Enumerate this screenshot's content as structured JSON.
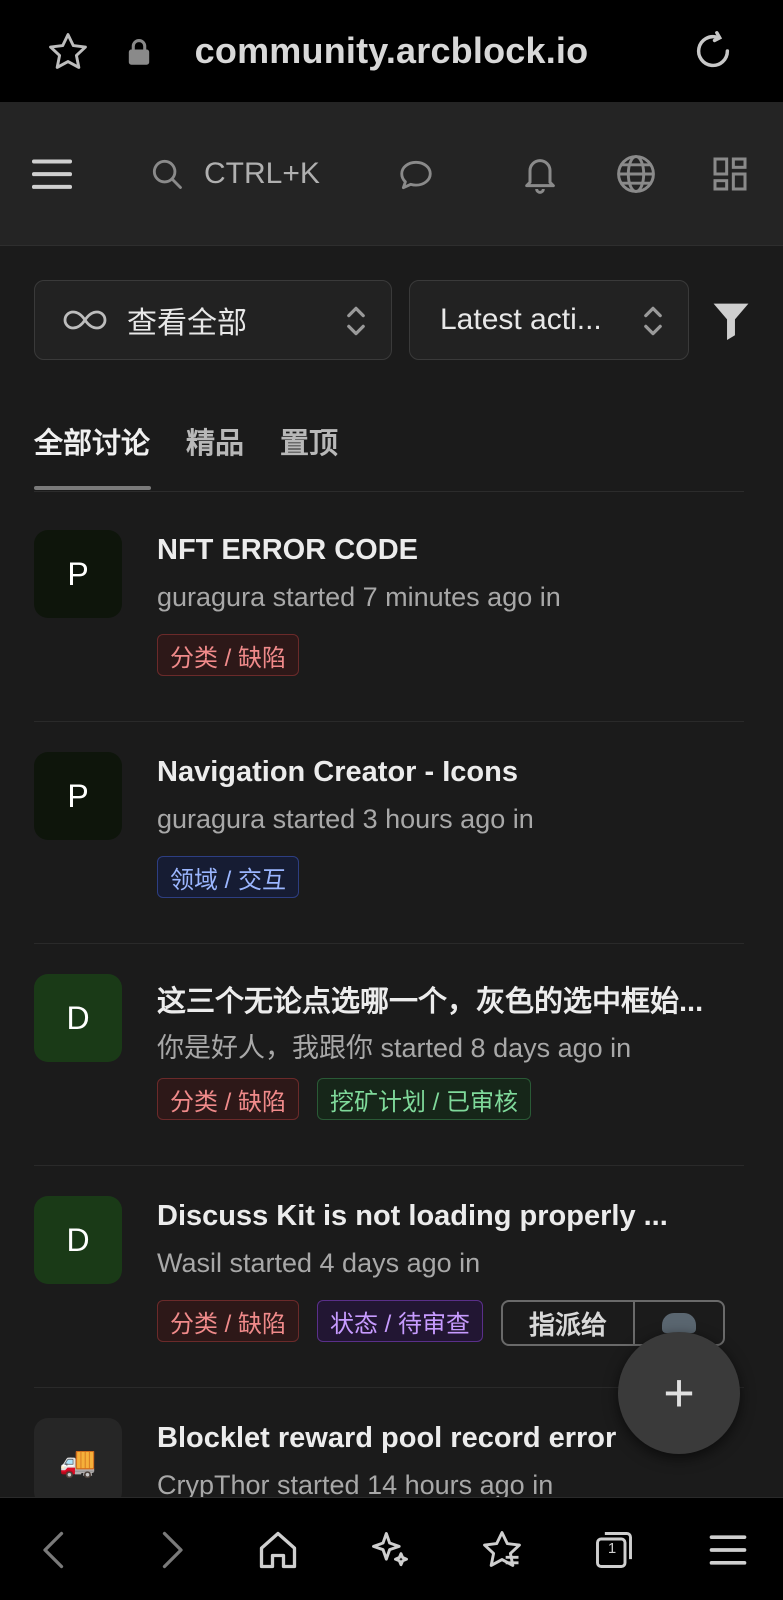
{
  "browser": {
    "url": "community.arcblock.io"
  },
  "header": {
    "search_shortcut": "CTRL+K"
  },
  "filters": {
    "category_label": "查看全部",
    "sort_label": "Latest acti..."
  },
  "tabs": [
    {
      "label": "全部讨论",
      "active": true
    },
    {
      "label": "精品",
      "active": false
    },
    {
      "label": "置顶",
      "active": false
    }
  ],
  "discussions": [
    {
      "avatar": "P",
      "title": "NFT ERROR CODE",
      "meta": "guragura started 7 minutes ago in",
      "tags": [
        {
          "text": "分类 / 缺陷",
          "color": "red"
        }
      ]
    },
    {
      "avatar": "P",
      "title": "Navigation Creator - Icons",
      "meta": "guragura started 3 hours ago in",
      "tags": [
        {
          "text": "领域 / 交互",
          "color": "blue"
        }
      ]
    },
    {
      "avatar": "D",
      "title": "这三个无论点选哪一个，灰色的选中框始...",
      "meta": "你是好人，我跟你 started 8 days ago in",
      "tags": [
        {
          "text": "分类 / 缺陷",
          "color": "red"
        },
        {
          "text": "挖矿计划 / 已审核",
          "color": "green"
        }
      ]
    },
    {
      "avatar": "D",
      "title": "Discuss Kit is not loading properly ...",
      "meta": "Wasil started 4 days ago in",
      "tags": [
        {
          "text": "分类 / 缺陷",
          "color": "red"
        },
        {
          "text": "状态 / 待审查",
          "color": "purple"
        }
      ],
      "assign_label": "指派给"
    },
    {
      "avatar": "🚚",
      "title": "Blocklet reward pool record error",
      "meta": "CrypThor started 14 hours ago in",
      "tags": []
    }
  ],
  "fab_label": "+",
  "bottom_bar_tab_count": "1"
}
